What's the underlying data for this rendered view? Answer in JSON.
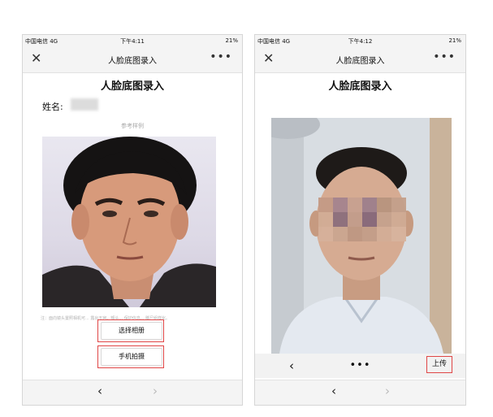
{
  "left_screen": {
    "status_bar": {
      "carrier": "中国电信 4G",
      "time": "下午4:11",
      "battery": "21%"
    },
    "navbar": {
      "close_icon": "close-icon",
      "title": "人脸底图录入",
      "more_icon": "more-dots-icon"
    },
    "page_title": "人脸底图录入",
    "name_label": "姓名:",
    "sample_label": "参考样例",
    "note": "注：面向镜头置照相机可... 露出五官、额头... 保护信息... 脚尸组样化。",
    "buttons": {
      "album": "选择相册",
      "camera": "手机拍摄"
    },
    "bottom_nav": {
      "back": "‹",
      "forward": "›"
    }
  },
  "right_screen": {
    "status_bar": {
      "carrier": "中国电信 4G",
      "time": "下午4:12",
      "battery": "21%"
    },
    "navbar": {
      "close_icon": "close-icon",
      "title": "人脸底图录入",
      "more_icon": "more-dots-icon"
    },
    "page_title": "人脸底图录入",
    "toolbar": {
      "back": "‹",
      "more": "•••",
      "upload": "上传"
    },
    "bottom_nav": {
      "back": "‹",
      "forward": "›"
    }
  },
  "colors": {
    "highlight": "#e04646",
    "bar": "#f4f4f4"
  }
}
